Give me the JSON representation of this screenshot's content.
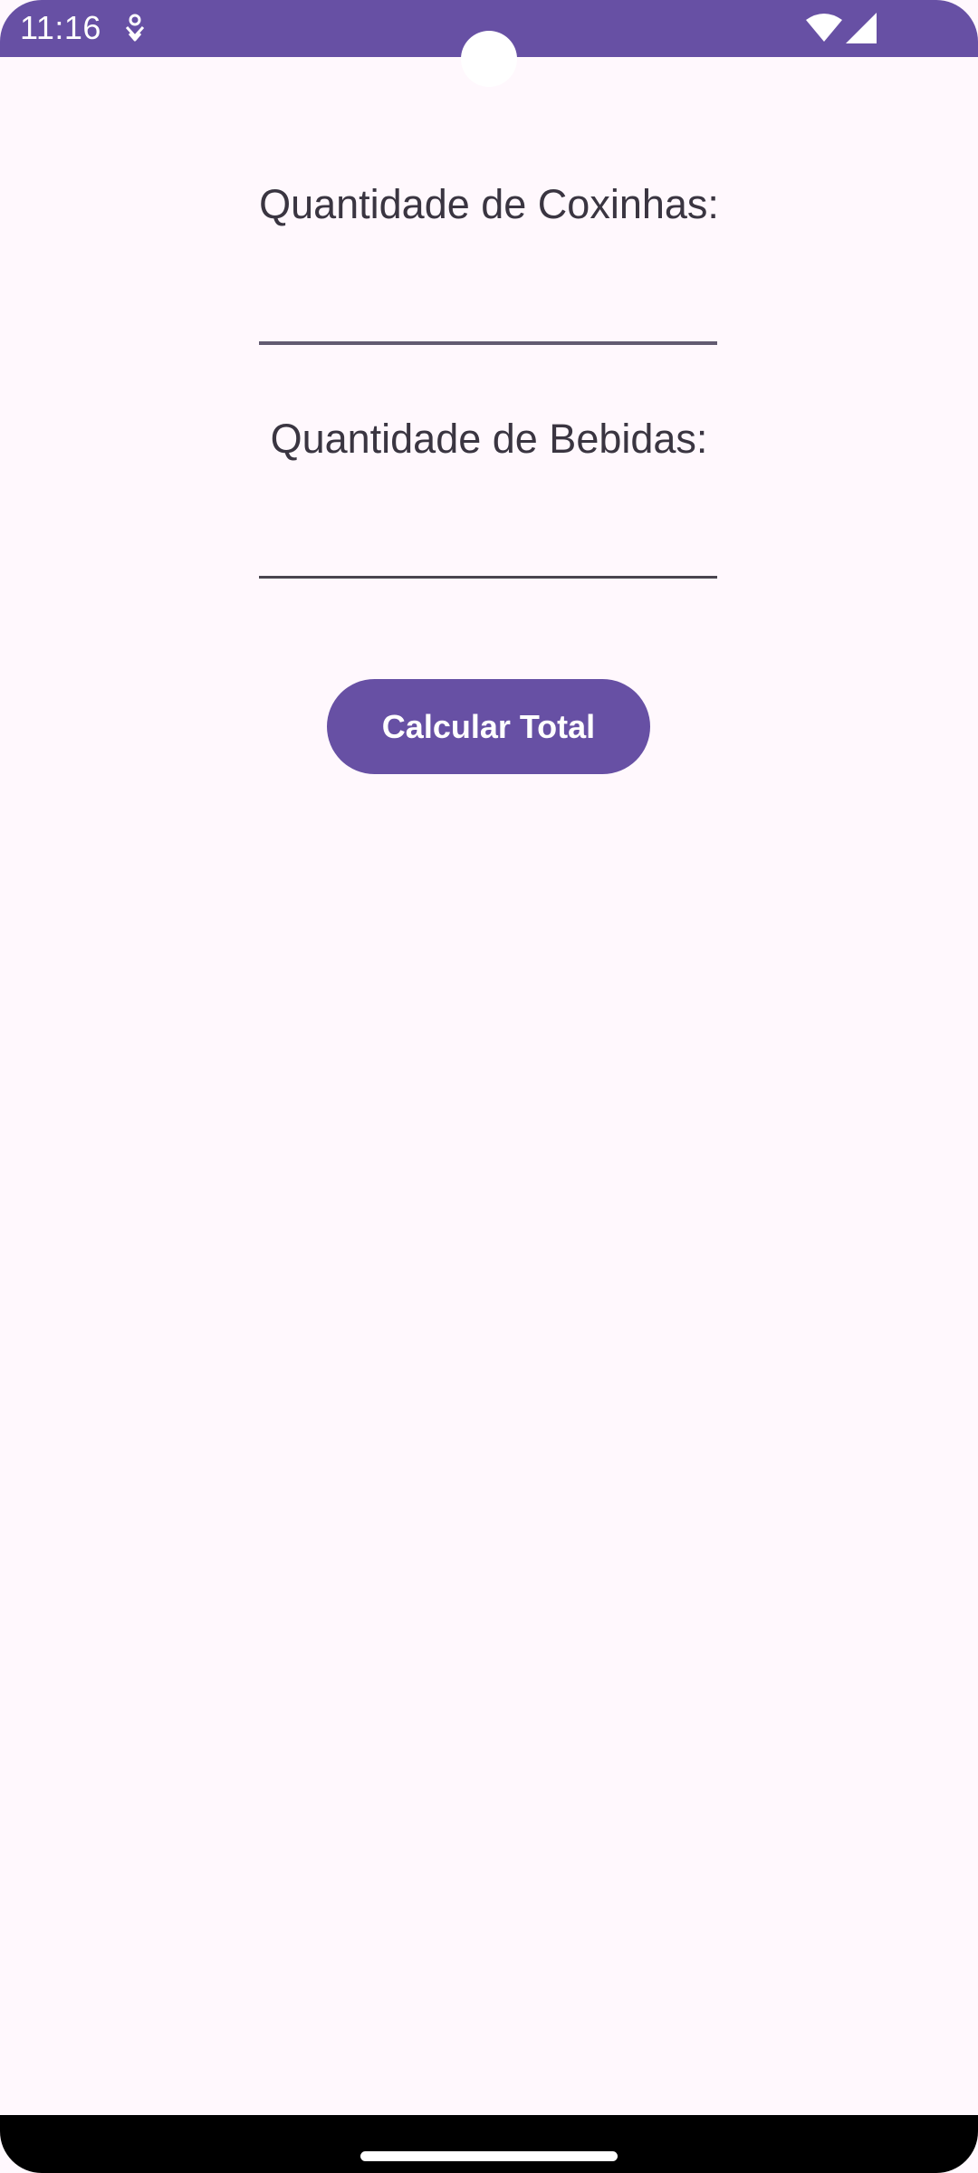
{
  "status_bar": {
    "time": "11:16",
    "icons": [
      "notification-icon",
      "wifi-icon",
      "signal-icon"
    ],
    "color": "#6750A4"
  },
  "form": {
    "coxinhas_label": "Quantidade de Coxinhas:",
    "coxinhas_value": "",
    "bebidas_label": "Quantidade de Bebidas:",
    "bebidas_value": "",
    "calculate_button_label": "Calcular Total"
  },
  "theme": {
    "primary": "#6750A4",
    "background": "#FFF8FD",
    "text": "#3A3541"
  }
}
